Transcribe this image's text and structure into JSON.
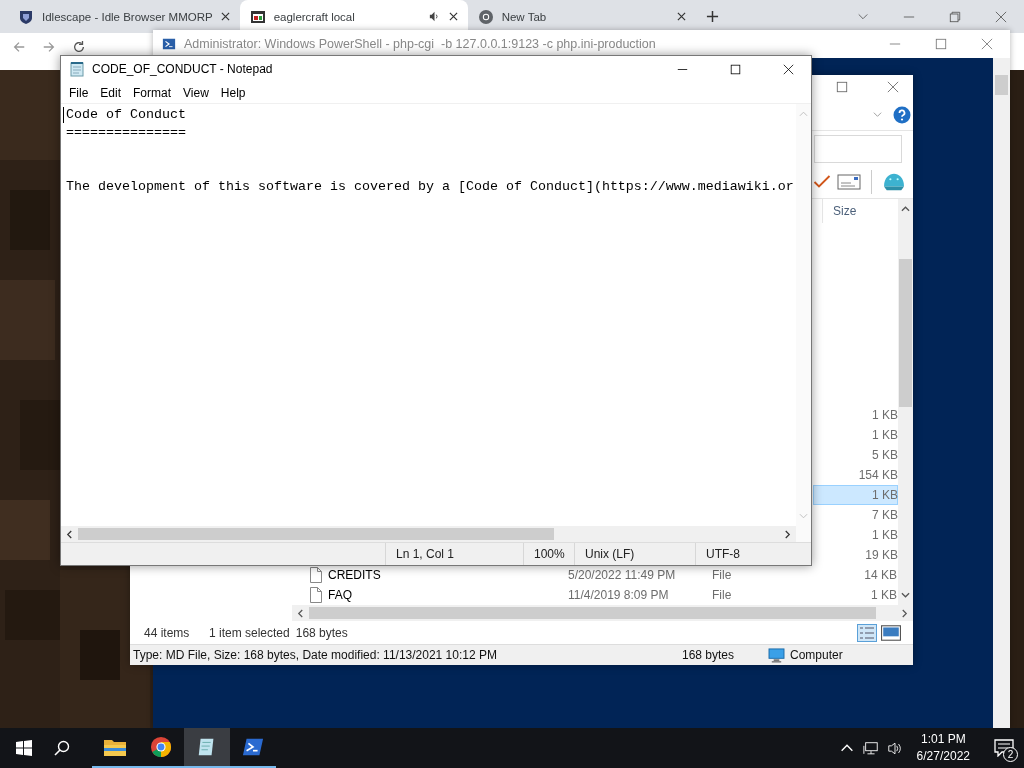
{
  "browser": {
    "tabs": [
      {
        "title": "Idlescape - Idle Browser MMORP",
        "selected": false,
        "audio": false
      },
      {
        "title": "eaglercraft local",
        "selected": true,
        "audio": true
      },
      {
        "title": "New Tab",
        "selected": false,
        "audio": false
      }
    ]
  },
  "powershell": {
    "title": "Administrator: Windows PowerShell - php-cgi  -b 127.0.0.1:9123 -c php.ini-production"
  },
  "explorer": {
    "columns": [
      "Size"
    ],
    "rows": [
      {
        "size": "1 KB",
        "selected": false
      },
      {
        "size": "1 KB",
        "selected": false
      },
      {
        "size": "5 KB",
        "selected": false
      },
      {
        "size": "154 KB",
        "selected": false
      },
      {
        "size": "1 KB",
        "selected": true
      },
      {
        "size": "7 KB",
        "selected": false
      },
      {
        "size": "1 KB",
        "selected": false
      },
      {
        "size": "19 KB",
        "selected": false
      },
      {
        "name": "CREDITS",
        "date": "5/20/2022 11:49 PM",
        "type": "File",
        "size": "14 KB",
        "selected": false
      },
      {
        "name": "FAQ",
        "date": "11/4/2019 8:09 PM",
        "type": "File",
        "size": "1 KB",
        "selected": false
      }
    ],
    "status": {
      "items": "44 items",
      "selection": "1 item selected",
      "selection_size": "168 bytes"
    },
    "details": {
      "text": "Type: MD File, Size: 168 bytes, Date modified: 11/13/2021 10:12 PM",
      "size": "168 bytes",
      "location": "Computer"
    }
  },
  "notepad": {
    "title": "CODE_OF_CONDUCT - Notepad",
    "menu": [
      "File",
      "Edit",
      "Format",
      "View",
      "Help"
    ],
    "lines": [
      {
        "text": "Code of Conduct",
        "gap_before": false
      },
      {
        "text": "===============",
        "gap_before": false
      },
      {
        "text": "The development of this software is covered by a [Code of Conduct](https://www.mediawiki.or",
        "gap_before": true
      }
    ],
    "status": [
      "Ln 1, Col 1",
      "100%",
      "Unix (LF)",
      "UTF-8"
    ]
  },
  "taskbar": {
    "apps": [
      {
        "kind": "explorer",
        "selected": false
      },
      {
        "kind": "chrome",
        "selected": false
      },
      {
        "kind": "notepad",
        "selected": true
      },
      {
        "kind": "powershell",
        "selected": false
      }
    ],
    "time": "1:01 PM",
    "date": "6/27/2022",
    "notifications": "2"
  }
}
